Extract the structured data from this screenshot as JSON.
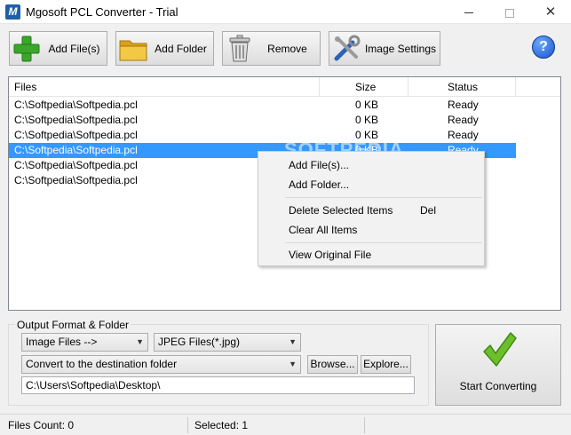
{
  "window": {
    "title": "Mgosoft PCL Converter - Trial",
    "app_icon_letter": "M"
  },
  "toolbar": {
    "add_files_label": "Add File(s)",
    "add_folder_label": "Add Folder",
    "remove_label": "Remove",
    "image_settings_label": "Image Settings",
    "help_label": "?"
  },
  "filelist": {
    "columns": [
      "Files",
      "Size",
      "Status"
    ],
    "rows": [
      {
        "file": "C:\\Softpedia\\Softpedia.pcl",
        "size": "0 KB",
        "status": "Ready"
      },
      {
        "file": "C:\\Softpedia\\Softpedia.pcl",
        "size": "0 KB",
        "status": "Ready"
      },
      {
        "file": "C:\\Softpedia\\Softpedia.pcl",
        "size": "0 KB",
        "status": "Ready"
      },
      {
        "file": "C:\\Softpedia\\Softpedia.pcl",
        "size": "0 KB",
        "status": "Ready"
      },
      {
        "file": "C:\\Softpedia\\Softpedia.pcl",
        "size": "",
        "status": ""
      },
      {
        "file": "C:\\Softpedia\\Softpedia.pcl",
        "size": "",
        "status": ""
      }
    ],
    "selected_row": 4,
    "watermark": "SOFTPEDIA"
  },
  "context_menu": {
    "add_files": "Add File(s)...",
    "add_folder": "Add Folder...",
    "delete_selected": "Delete Selected Items",
    "delete_shortcut": "Del",
    "clear_all": "Clear All Items",
    "view_original": "View Original File"
  },
  "output": {
    "group_title": "Output Format & Folder",
    "format_type": "Image Files -->",
    "format_subtype": "JPEG Files(*.jpg)",
    "destination_mode": "Convert to the destination folder",
    "browse_label": "Browse...",
    "explore_label": "Explore...",
    "path": "C:\\Users\\Softpedia\\Desktop\\"
  },
  "start": {
    "label": "Start Converting"
  },
  "status": {
    "files_count": "Files Count: 0",
    "selected": "Selected: 1"
  },
  "colors": {
    "selection": "#3399ff",
    "help_blue": "#1a56c8",
    "plus_green": "#3aa62a",
    "check_green": "#6cbf2a"
  }
}
